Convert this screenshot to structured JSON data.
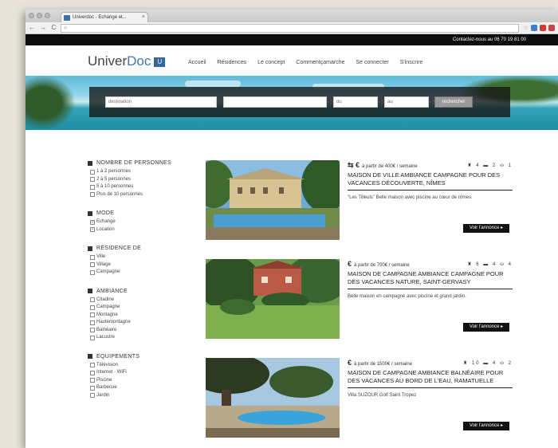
{
  "browser": {
    "tab_title": "Univerdoc - Echange et...",
    "tab_close": "×",
    "nav_buttons": "← → C",
    "url": "⌂",
    "star": "☆"
  },
  "topbar": {
    "contact": "Contactez-nous au 06 70 19 81 00"
  },
  "header": {
    "logo_part1": "Univer",
    "logo_part2": "Doc",
    "logo_badge": "U",
    "menu": [
      "Accueil",
      "Résidences",
      "Le concept",
      "Commentçamarche",
      "Se connecter",
      "S'inscrire"
    ]
  },
  "search": {
    "field1_placeholder": "destination",
    "field2_placeholder": "",
    "field3_placeholder": "du",
    "field4_placeholder": "au",
    "button": "rechercher"
  },
  "filters": [
    {
      "title": "NOMBRE DE PERSONNES",
      "options": [
        {
          "label": "1 à 2 personnes",
          "checked": false
        },
        {
          "label": "2 à 5 personnes",
          "checked": false
        },
        {
          "label": "5 à 10 personnes",
          "checked": false
        },
        {
          "label": "Plus de 10 personnes",
          "checked": false
        }
      ]
    },
    {
      "title": "MODE",
      "options": [
        {
          "label": "Echange",
          "checked": true
        },
        {
          "label": "Location",
          "checked": true
        }
      ]
    },
    {
      "title": "RÉSIDENCE DE",
      "options": [
        {
          "label": "Ville",
          "checked": false
        },
        {
          "label": "Village",
          "checked": false
        },
        {
          "label": "Campagne",
          "checked": false
        }
      ]
    },
    {
      "title": "AMBIANCE",
      "options": [
        {
          "label": "Citadine",
          "checked": false
        },
        {
          "label": "Campagne",
          "checked": false
        },
        {
          "label": "Montagne",
          "checked": false
        },
        {
          "label": "Hautemontagne",
          "checked": false
        },
        {
          "label": "Balnéaire",
          "checked": false
        },
        {
          "label": "Lacustre",
          "checked": false
        }
      ]
    },
    {
      "title": "EQUIPEMENTS",
      "options": [
        {
          "label": "Télévision",
          "checked": false
        },
        {
          "label": "Internet - WiFi",
          "checked": false
        },
        {
          "label": "Piscine",
          "checked": false
        },
        {
          "label": "Barbecue",
          "checked": false
        },
        {
          "label": "Jardin",
          "checked": false
        }
      ]
    }
  ],
  "listings": [
    {
      "mode_icons": "⇆ €",
      "price_text": "à partir de 400€ / semaine",
      "capacity": "♜ 4  ▬ 2  ⛀ 1",
      "title": "MAISON DE VILLE AMBIANCE CAMPAGNE POUR DES VACANCES DÉCOUVERTE, NÎMES",
      "desc": "\"Les Tilleuls\" Belle maison avec piscine au cœur de nîmes.",
      "button": "Voir l'annonce ▸"
    },
    {
      "mode_icons": "€",
      "price_text": "à partir de 700€ / semaine",
      "capacity": "♜ 6  ▬ 4  ⛀ 4",
      "title": "MAISON DE CAMPAGNE AMBIANCE CAMPAGNE POUR DES VACANCES NATURE, SAINT-GERVASY",
      "desc": "Belle maison en campagne avec piscine et grand jardin.",
      "button": "Voir l'annonce ▸"
    },
    {
      "mode_icons": "€",
      "price_text": "à partir de 1500€ / semaine",
      "capacity": "♜ 10  ▬ 4  ⛀ 2",
      "title": "MAISON DE CAMPAGNE AMBIANCE BALNÉAIRE POUR DES VACANCES AU BORD DE L'EAU, RAMATUELLE",
      "desc": "Villa SUZOUR Golf Saint Tropez",
      "button": "Voir l'annonce ▸"
    }
  ],
  "colors": {
    "brand": "#3f78b0",
    "dark": "#111111"
  }
}
